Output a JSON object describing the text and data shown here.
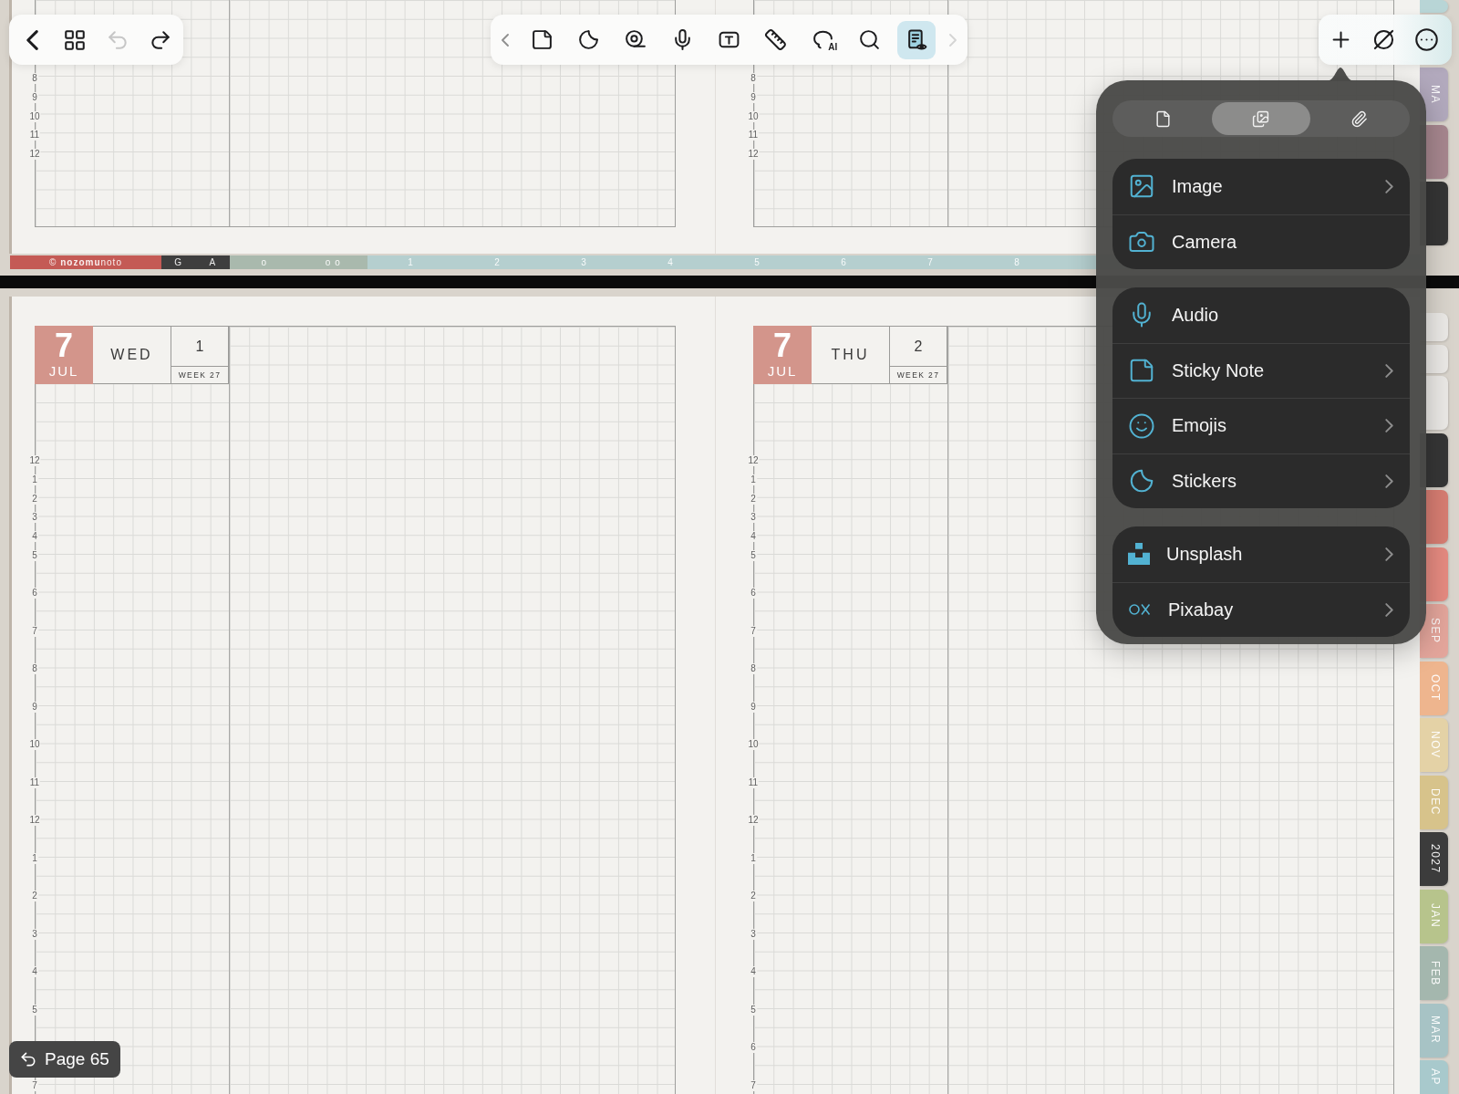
{
  "toolbar_left": [
    {
      "kind": "back",
      "disabled": false
    },
    {
      "kind": "pages",
      "disabled": false
    },
    {
      "kind": "undo",
      "disabled": true
    },
    {
      "kind": "redo",
      "disabled": false
    }
  ],
  "toolbar_center": {
    "scroll_left": {
      "disabled": false
    },
    "tools": [
      {
        "kind": "sticky-note",
        "selected": false
      },
      {
        "kind": "sticker",
        "selected": false
      },
      {
        "kind": "tape",
        "selected": false
      },
      {
        "kind": "audio",
        "selected": false
      },
      {
        "kind": "text-box",
        "selected": false
      },
      {
        "kind": "ruler",
        "selected": false
      },
      {
        "kind": "ai-lasso",
        "badge": "AI",
        "selected": false
      },
      {
        "kind": "search",
        "selected": false
      },
      {
        "kind": "reader",
        "selected": true
      }
    ],
    "scroll_right": {
      "disabled": true
    }
  },
  "toolbar_right": [
    {
      "kind": "add"
    },
    {
      "kind": "hide"
    },
    {
      "kind": "more"
    }
  ],
  "top_spread": {
    "pages": [
      {
        "hours": [
          "8",
          "9",
          "10",
          "11",
          "12"
        ]
      },
      {
        "hours": [
          "8",
          "9",
          "10",
          "11",
          "12"
        ]
      }
    ],
    "side_tabs": [
      {
        "kind": "stub",
        "color": "#b8d5d6"
      },
      {
        "kind": "tall",
        "label": "MA",
        "color": "#b2a9bd"
      },
      {
        "kind": "tall",
        "color": "#a6868e"
      },
      {
        "kind": "long",
        "color": "#353535"
      }
    ],
    "index_strip": [
      {
        "kind": "brand",
        "label": "© **nozomu**noto",
        "color": "#c45a55"
      },
      {
        "kind": "letter",
        "label": "G",
        "color": "#3e3e3e"
      },
      {
        "kind": "letter",
        "label": "A",
        "color": "#3e3e3e"
      },
      {
        "kind": "wide",
        "label": "o",
        "color": "#a9b9ad"
      },
      {
        "kind": "wide",
        "label": "o o",
        "color": "#a9b9ad"
      },
      {
        "kind": "number",
        "label": "1",
        "color": "#b5cfcf"
      },
      {
        "kind": "number",
        "label": "2",
        "color": "#b5cfcf"
      },
      {
        "kind": "number",
        "label": "3",
        "color": "#b5cfcf"
      },
      {
        "kind": "number",
        "label": "4",
        "color": "#b5cfcf"
      },
      {
        "kind": "number",
        "label": "5",
        "color": "#b5cfcf"
      },
      {
        "kind": "number",
        "label": "6",
        "color": "#b5cfcf"
      },
      {
        "kind": "number",
        "label": "7",
        "color": "#b5cfcf"
      },
      {
        "kind": "number",
        "label": "8",
        "color": "#b5cfcf"
      }
    ]
  },
  "bottom_spread": {
    "pages": [
      {
        "header": {
          "month_number": "7",
          "month": "JUL",
          "weekday": "WED",
          "day": "1",
          "week": "WEEK 27"
        },
        "hours": [
          "12",
          "1",
          "2",
          "3",
          "4",
          "5",
          "6",
          "7",
          "8",
          "9",
          "10",
          "11",
          "12",
          "1",
          "2",
          "3",
          "4",
          "5"
        ],
        "bottom_hour": "7"
      },
      {
        "header": {
          "month_number": "7",
          "month": "JUL",
          "weekday": "THU",
          "day": "2",
          "week": "WEEK 27"
        },
        "hours": [
          "12",
          "1",
          "2",
          "3",
          "4",
          "5",
          "6",
          "7",
          "8",
          "9",
          "10",
          "11",
          "12",
          "1",
          "2",
          "3",
          "4",
          "5",
          "6"
        ],
        "bottom_hour": "7"
      }
    ],
    "side_tabs": [
      {
        "kind": "short",
        "color": "#ebe9e6"
      },
      {
        "kind": "short",
        "color": "#ebe9e6"
      },
      {
        "kind": "tall",
        "color": "#ebe9e6"
      },
      {
        "kind": "tall",
        "color": "#363636"
      },
      {
        "kind": "tall",
        "color": "#d77d72"
      },
      {
        "kind": "tall",
        "color": "#e58a80"
      },
      {
        "kind": "tall",
        "label": "SEP",
        "color": "#e3a59b"
      },
      {
        "kind": "tall",
        "label": "OCT",
        "color": "#eeb58e"
      },
      {
        "kind": "tall",
        "label": "NOV",
        "color": "#e4d2a6"
      },
      {
        "kind": "tall",
        "label": "DEC",
        "color": "#d7c38b"
      },
      {
        "kind": "tall",
        "label": "2027",
        "color": "#3c3c3c"
      },
      {
        "kind": "tall",
        "label": "JAN",
        "color": "#b7c48c"
      },
      {
        "kind": "tall",
        "label": "FEB",
        "color": "#a4b7ae"
      },
      {
        "kind": "tall",
        "label": "MAR",
        "color": "#a7c3c5"
      },
      {
        "kind": "cut",
        "label": "AP",
        "color": "#a8c9cc"
      }
    ]
  },
  "popover": {
    "tabs": [
      {
        "kind": "document",
        "selected": false
      },
      {
        "kind": "media",
        "selected": true
      },
      {
        "kind": "attachment",
        "selected": false
      }
    ],
    "groups": [
      {
        "items": [
          {
            "kind": "image",
            "label": "Image",
            "submenu": true
          },
          {
            "kind": "camera",
            "label": "Camera",
            "submenu": false
          }
        ]
      },
      {
        "items": [
          {
            "kind": "audio",
            "label": "Audio",
            "submenu": false
          },
          {
            "kind": "sticky-note",
            "label": "Sticky Note",
            "submenu": true
          },
          {
            "kind": "emojis",
            "label": "Emojis",
            "submenu": true
          },
          {
            "kind": "stickers",
            "label": "Stickers",
            "submenu": true
          }
        ]
      },
      {
        "items": [
          {
            "kind": "unsplash",
            "label": "Unsplash",
            "submenu": true
          },
          {
            "kind": "pixabay",
            "label": "Pixabay",
            "submenu": true
          }
        ]
      }
    ]
  },
  "page_indicator": {
    "label": "Page 65"
  }
}
